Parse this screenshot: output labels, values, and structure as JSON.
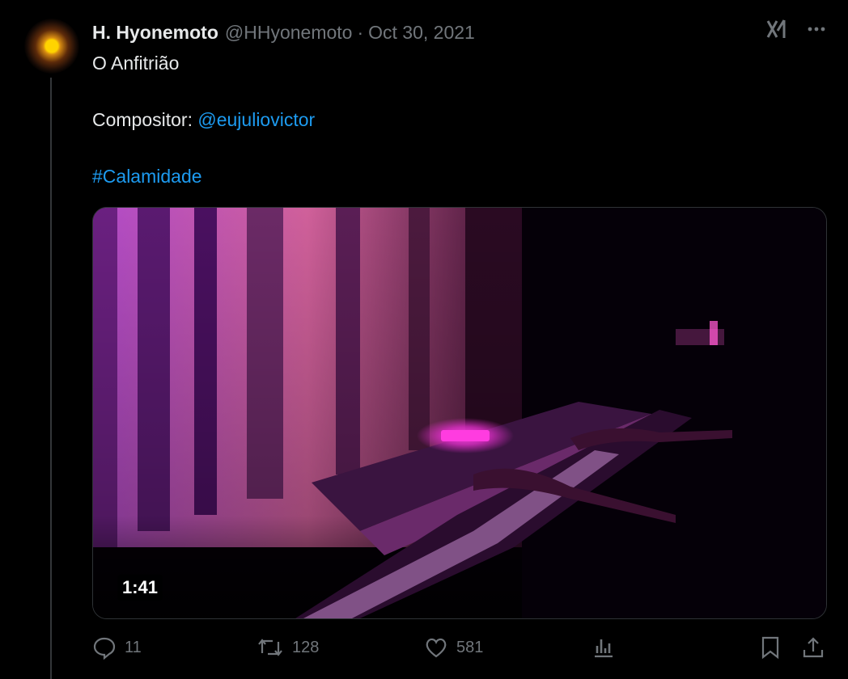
{
  "post": {
    "author_name": "H. Hyonemoto",
    "author_handle": "@HHyonemoto",
    "separator": "·",
    "date": "Oct 30, 2021",
    "title_line": "O Anfitrião",
    "composer_label": "Compositor:",
    "composer_mention": "@eujuliovictor",
    "hashtag": "#Calamidade",
    "video_duration": "1:41"
  },
  "actions": {
    "replies": "11",
    "reposts": "128",
    "likes": "581"
  },
  "icons": {
    "grok": "grok-icon",
    "more": "more-icon",
    "reply": "reply-icon",
    "repost": "repost-icon",
    "like": "like-icon",
    "views": "views-icon",
    "bookmark": "bookmark-icon",
    "share": "share-icon"
  },
  "colors": {
    "link": "#1d9bf0",
    "muted": "#71767b",
    "text": "#e7e9ea",
    "background": "#000000"
  }
}
